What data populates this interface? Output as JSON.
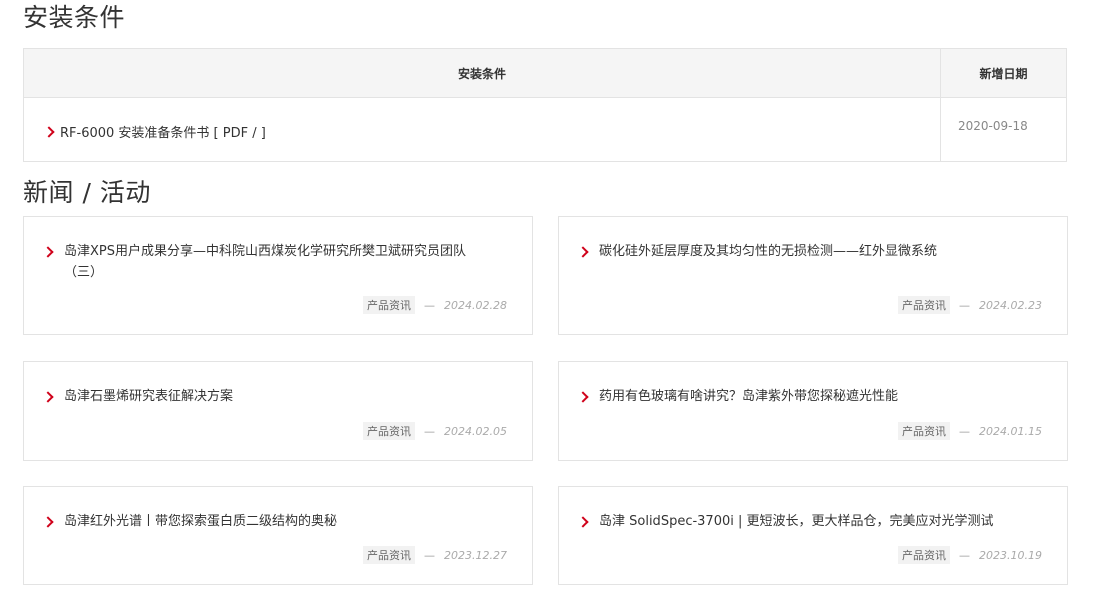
{
  "install": {
    "title": "安装条件",
    "col_main": "安装条件",
    "col_date": "新增日期",
    "rows": [
      {
        "label": "RF-6000 安装准备条件书 [ PDF / ]",
        "date": "2020-09-18"
      }
    ]
  },
  "news": {
    "title": "新闻 / 活动",
    "separator": "—",
    "items": [
      {
        "title": "岛津XPS用户成果分享—中科院山西煤炭化学研究所樊卫斌研究员团队（三）",
        "tag": "产品资讯",
        "date": "2024.02.28"
      },
      {
        "title": "碳化硅外延层厚度及其均匀性的无损检测——红外显微系统",
        "tag": "产品资讯",
        "date": "2024.02.23"
      },
      {
        "title": "岛津石墨烯研究表征解决方案",
        "tag": "产品资讯",
        "date": "2024.02.05"
      },
      {
        "title": "药用有色玻璃有啥讲究？岛津紫外带您探秘遮光性能",
        "tag": "产品资讯",
        "date": "2024.01.15"
      },
      {
        "title": "岛津红外光谱丨带您探索蛋白质二级结构的奥秘",
        "tag": "产品资讯",
        "date": "2023.12.27"
      },
      {
        "title": "岛津 SolidSpec-3700i | 更短波长，更大样品仓，完美应对光学测试",
        "tag": "产品资讯",
        "date": "2023.10.19"
      }
    ]
  },
  "colors": {
    "accent": "#d0021b",
    "border": "#e3e3e3",
    "header_bg": "#f5f5f5"
  }
}
